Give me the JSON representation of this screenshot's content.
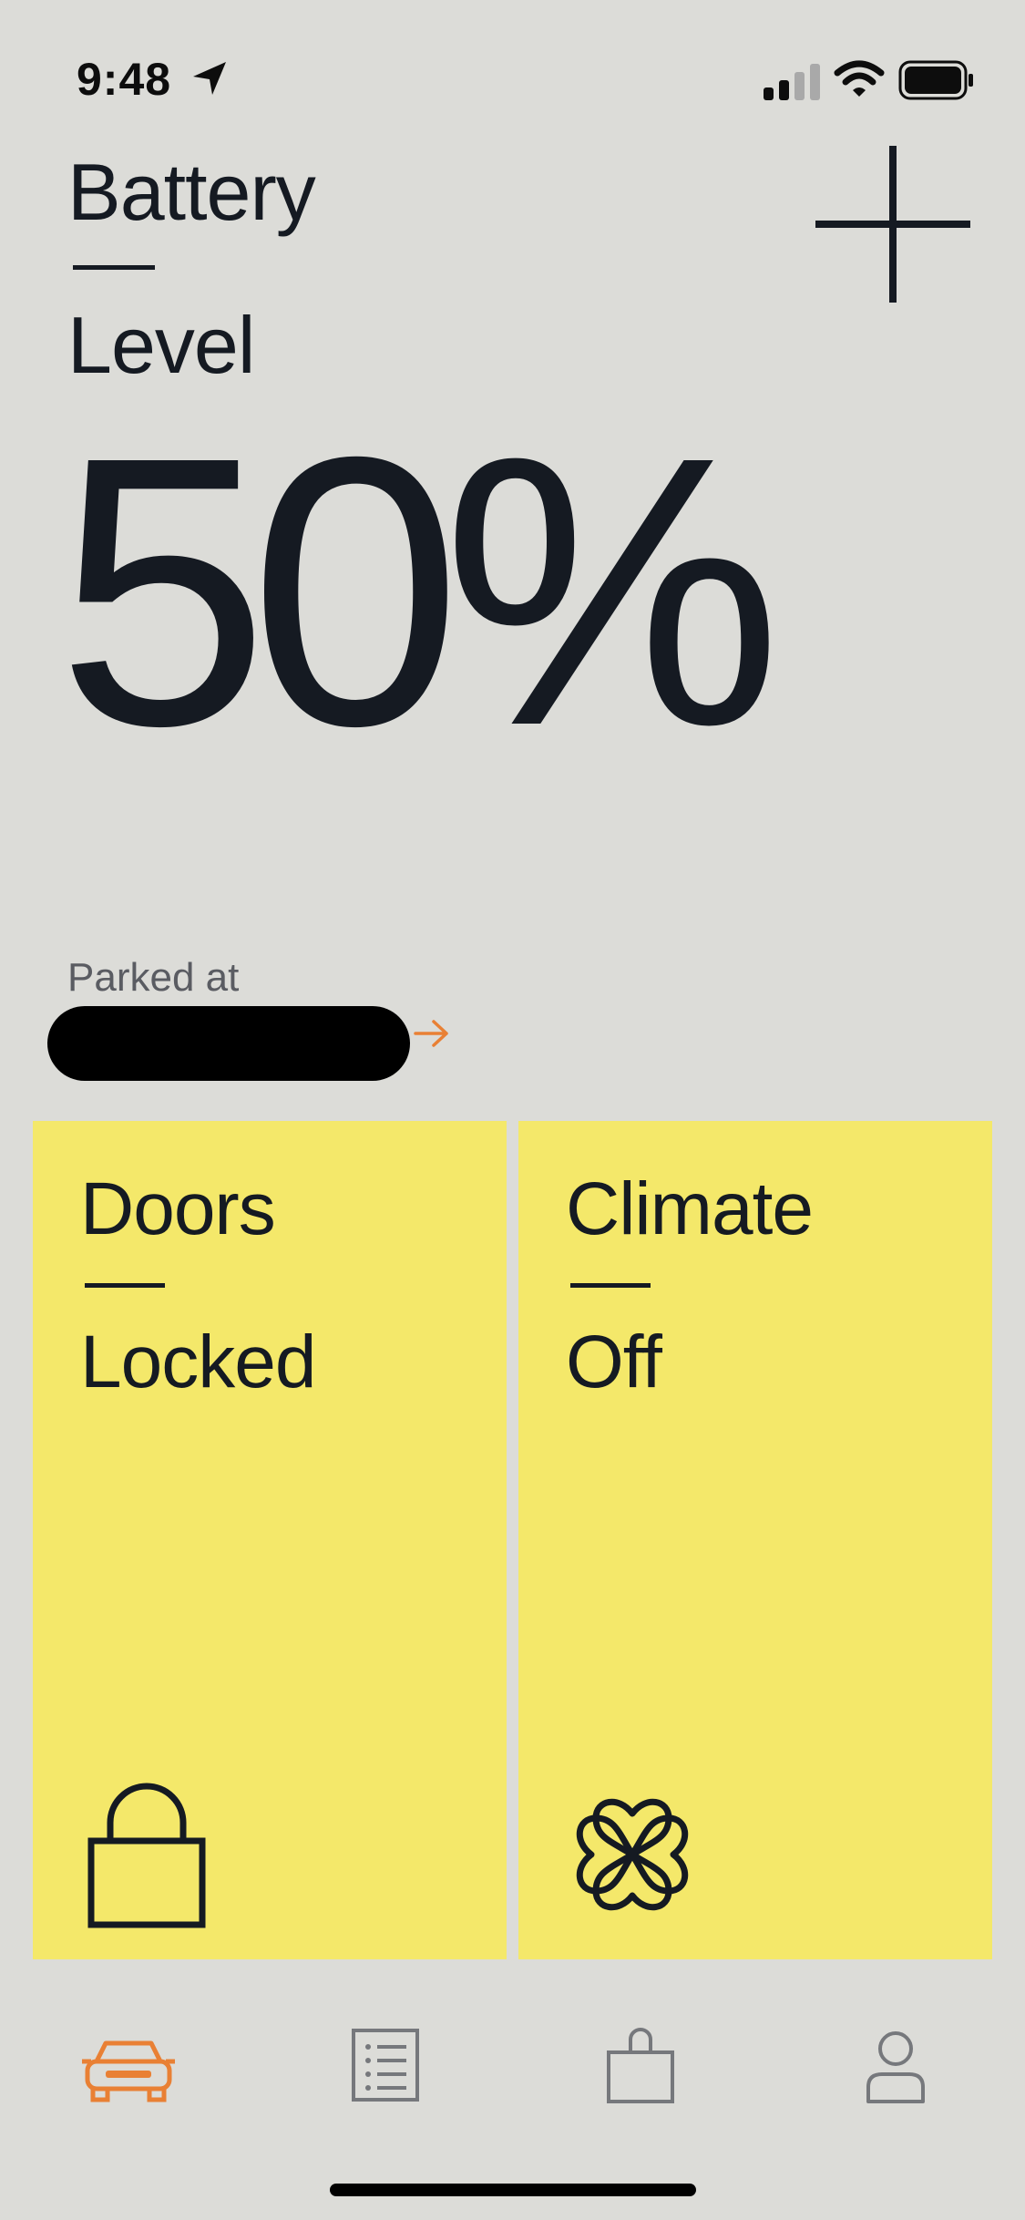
{
  "status_bar": {
    "time": "9:48",
    "icons": [
      "location-arrow-icon",
      "cellular-signal-icon",
      "wifi-icon",
      "battery-icon"
    ]
  },
  "header": {
    "title_line1": "Battery",
    "title_line2": "Level",
    "add_icon": "plus-icon"
  },
  "battery": {
    "level_text": "50%"
  },
  "location": {
    "label": "Parked at",
    "address": "",
    "arrow_icon": "arrow-right-icon"
  },
  "cards": {
    "doors": {
      "title": "Doors",
      "status": "Locked",
      "icon": "lock-icon"
    },
    "climate": {
      "title": "Climate",
      "status": "Off",
      "icon": "fan-icon"
    }
  },
  "tab_bar": {
    "items": [
      {
        "icon": "car-icon",
        "active": true
      },
      {
        "icon": "list-icon",
        "active": false
      },
      {
        "icon": "shopping-bag-icon",
        "active": false
      },
      {
        "icon": "profile-icon",
        "active": false
      }
    ]
  },
  "colors": {
    "background": "#dcdcd8",
    "card": "#f4e86a",
    "text": "#151a22",
    "accent": "#e98034",
    "inactive_icon": "#76787c"
  }
}
